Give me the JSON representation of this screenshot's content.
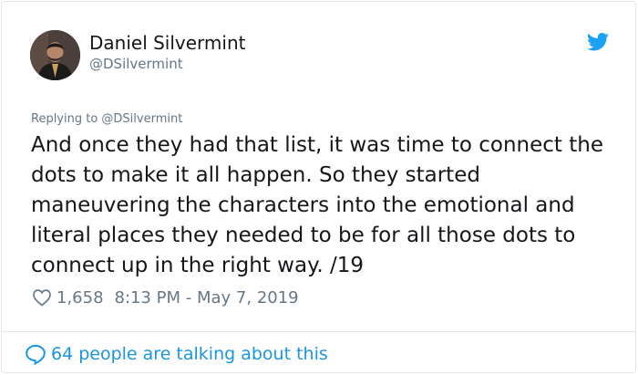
{
  "tweet": {
    "author_name": "Daniel Silvermint",
    "author_handle": "@DSilvermint",
    "replying_to": "Replying to @DSilvermint",
    "text": "And once they had that list, it was time to connect the dots to make it all happen. So they started maneuvering the characters into the emotional and literal places they needed to be for all those dots to connect up in the right way.  /19",
    "likes": "1,658",
    "timestamp": "8:13 PM - May 7, 2019",
    "talking": "64 people are talking about this"
  },
  "colors": {
    "accent": "#1da1f2",
    "link": "#1b95e0",
    "muted": "#657786",
    "text": "#14171a",
    "border": "#e1e8ed"
  },
  "icons": {
    "brand": "twitter-bird-icon",
    "like": "heart-icon",
    "reply": "speech-bubble-icon"
  }
}
